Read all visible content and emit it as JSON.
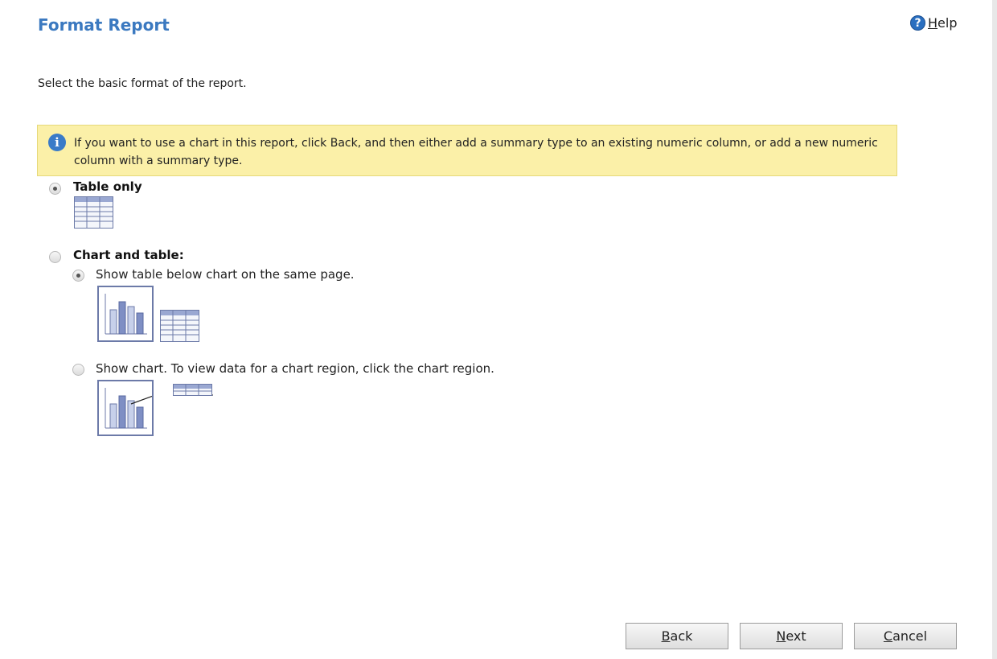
{
  "page": {
    "title": "Format Report",
    "help_label": "Help",
    "subtitle": "Select the basic format of the report."
  },
  "notice": {
    "icon": "info-icon",
    "text": "If you want to use a chart in this report, click Back, and then either add a summary type to an existing numeric column, or add a new numeric column with a summary type."
  },
  "options": {
    "table_only": {
      "label": "Table only",
      "selected": true
    },
    "chart_and_table": {
      "label": "Chart and table:",
      "selected": false,
      "sub": [
        {
          "label": "Show table below chart on the same page.",
          "selected": true
        },
        {
          "label": "Show chart. To view data for a chart region, click the chart region.",
          "selected": false
        }
      ]
    }
  },
  "buttons": {
    "back": {
      "key": "B",
      "rest": "ack"
    },
    "next": {
      "key": "N",
      "rest": "ext"
    },
    "cancel": {
      "key": "C",
      "rest": "ancel"
    }
  },
  "colors": {
    "title": "#3b79c0",
    "notice_bg": "#fbf0a8",
    "thumb": "#6c7aa8"
  }
}
